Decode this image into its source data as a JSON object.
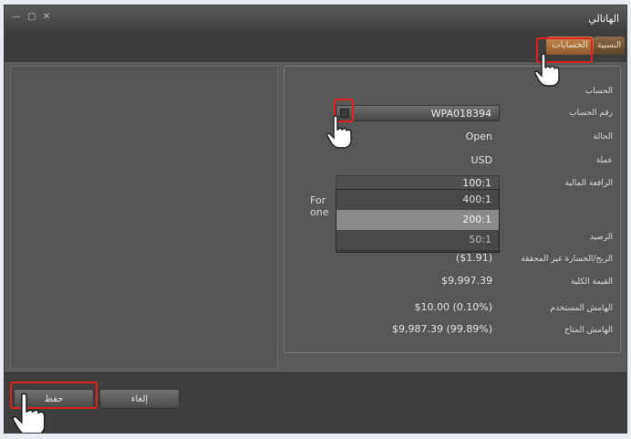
{
  "window": {
    "title": "الهاتالي",
    "controls": "— ▢ ✕"
  },
  "tabs": [
    {
      "label": "الحسابات",
      "active": true
    },
    {
      "label": "النسبية",
      "active": false
    }
  ],
  "account": {
    "section_label": "الحساب",
    "number_label": "رقم الحساب",
    "number_value": "WPA018394",
    "status_label": "الحالة",
    "status_value": "Open",
    "currency_label": "عملة",
    "currency_value": "USD",
    "leverage_label": "الرافعة المالية",
    "leverage_value": "100:1",
    "leverage_options": [
      "400:1",
      "200:1",
      "50:1"
    ],
    "leverage_tooltip": "For one",
    "balance_label": "الرصيد",
    "pl_label": "الربح/الخسارة غير المحققة",
    "pl_value": "($1.91)",
    "equity_label": "القيمة الكلية",
    "equity_value": "$9,997.39",
    "used_margin_label": "الهامش المستخدم",
    "used_margin_value": "$10.00 (0.10%)",
    "free_margin_label": "الهامش المتاح",
    "free_margin_value": "$9,987.39 (99.89%)"
  },
  "footer": {
    "ok_label": "حفظ",
    "cancel_label": "إلغاء"
  },
  "colors": {
    "highlight": "#e02020",
    "tab_active": "#c68a4d"
  }
}
